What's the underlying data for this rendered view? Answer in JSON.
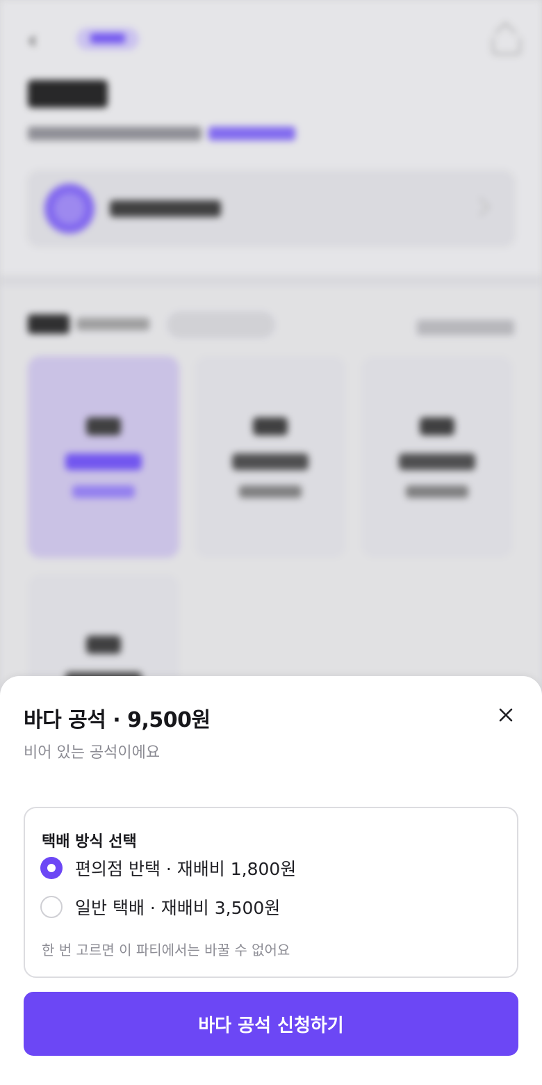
{
  "sheet": {
    "title": "바다 공석 · 9,500원",
    "subtitle": "비어 있는 공석이에요",
    "close_icon": "close-icon"
  },
  "delivery": {
    "title": "택배 방식 선택",
    "options": [
      {
        "label": "편의점 반택 · 재배비 1,800원",
        "selected": true
      },
      {
        "label": "일반 택배 · 재배비 3,500원",
        "selected": false
      }
    ],
    "note": "한 번 고르면 이 파티에서는 바꿀 수 없어요"
  },
  "cta": {
    "label": "바다 공석 신청하기"
  },
  "colors": {
    "accent": "#6c47f5",
    "card_border": "#dcdce0",
    "muted_text": "#8b8b93"
  }
}
